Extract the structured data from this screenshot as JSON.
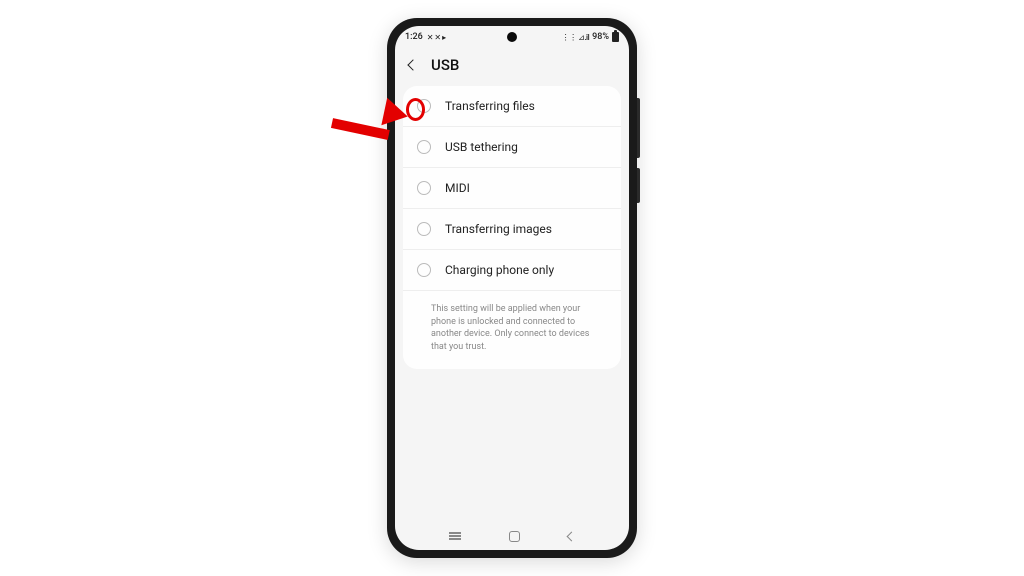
{
  "status_bar": {
    "time": "1:26",
    "battery_text": "98%",
    "left_icons": "✕ ✕ ▸",
    "right_icons": "⋮⋮ ⊿.il"
  },
  "header": {
    "title": "USB"
  },
  "options": [
    {
      "label": "Transferring files"
    },
    {
      "label": "USB tethering"
    },
    {
      "label": "MIDI"
    },
    {
      "label": "Transferring images"
    },
    {
      "label": "Charging phone only"
    }
  ],
  "help_text": "This setting will be applied when your phone is unlocked and connected to another device. Only connect to devices that you trust."
}
